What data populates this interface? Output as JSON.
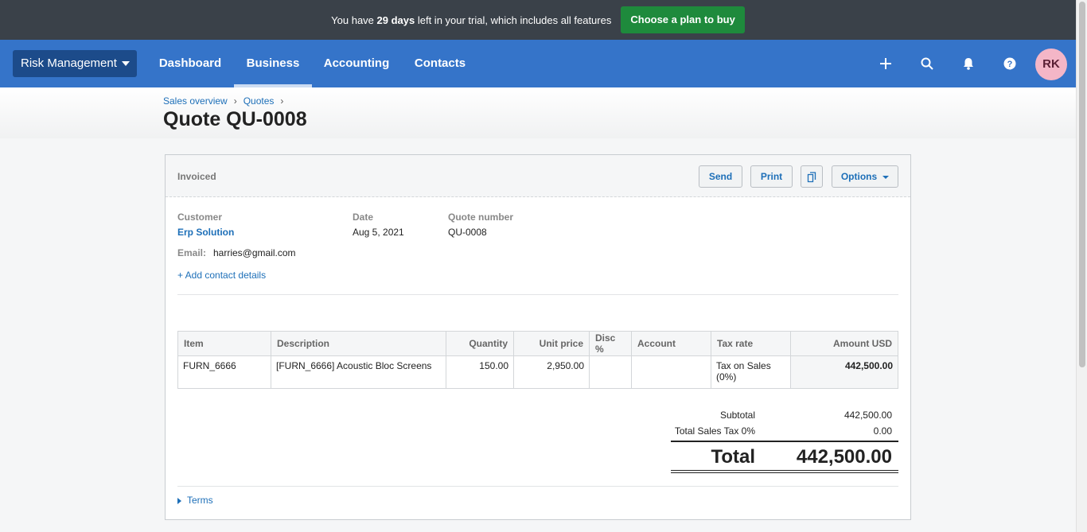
{
  "trial_bar": {
    "text_before": "You have ",
    "days": "29 days",
    "text_after": " left in your trial, which includes all features",
    "button_label": "Choose a plan to buy"
  },
  "nav": {
    "org_name": "Risk Management",
    "tabs": [
      "Dashboard",
      "Business",
      "Accounting",
      "Contacts"
    ],
    "active_tab": "Business",
    "icons": [
      "plus-icon",
      "search-icon",
      "bell-icon",
      "help-icon"
    ],
    "avatar_initials": "RK"
  },
  "breadcrumb": [
    "Sales overview",
    "Quotes"
  ],
  "page_title": "Quote QU-0008",
  "quote": {
    "status": "Invoiced",
    "buttons": {
      "send": "Send",
      "print": "Print",
      "options": "Options"
    },
    "customer_label": "Customer",
    "customer_name": "Erp Solution",
    "date_label": "Date",
    "date_value": "Aug 5, 2021",
    "number_label": "Quote number",
    "number_value": "QU-0008",
    "email_label": "Email:",
    "email_value": "harries@gmail.com",
    "add_contact": "+ Add contact details"
  },
  "table": {
    "headers": {
      "item": "Item",
      "description": "Description",
      "quantity": "Quantity",
      "unit_price": "Unit price",
      "disc": "Disc %",
      "account": "Account",
      "tax_rate": "Tax rate",
      "amount": "Amount USD"
    },
    "rows": [
      {
        "item": "FURN_6666",
        "description": "[FURN_6666] Acoustic Bloc Screens",
        "quantity": "150.00",
        "unit_price": "2,950.00",
        "disc": "",
        "account": "",
        "tax_rate": "Tax on Sales (0%)",
        "amount": "442,500.00"
      }
    ]
  },
  "totals": {
    "subtotal_label": "Subtotal",
    "subtotal_value": "442,500.00",
    "tax_label": "Total Sales Tax 0%",
    "tax_value": "0.00",
    "total_label": "Total",
    "total_value": "442,500.00"
  },
  "terms_label": "Terms",
  "colors": {
    "trial_bar": "#3a4149",
    "plan_button": "#1e8a3c",
    "nav": "#3574c9",
    "org_button": "#1c4b8a",
    "link": "#1d6fb8",
    "avatar": "#f4b6c7"
  }
}
